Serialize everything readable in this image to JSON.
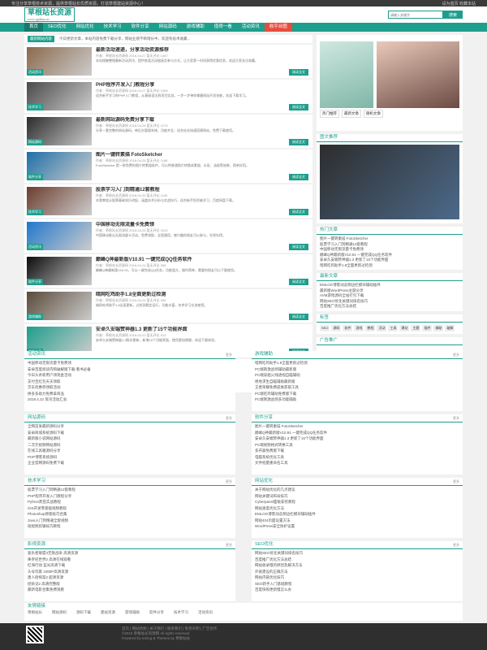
{
  "topbar": {
    "left": "专注分享草根技术资源，提供草根站长优质资源，打造草根建站资源中心！",
    "right": "设为首页 收藏本站"
  },
  "brand": {
    "title": "草根站长资源",
    "url": "www.cgzhan.cn"
  },
  "search": {
    "placeholder": "请输入关键字",
    "button": "搜索"
  },
  "nav": [
    "首页",
    "SEO优化",
    "网站优化",
    "技术学习",
    "软件分享",
    "网站源码",
    "游戏辅助",
    "值得一看",
    "活动资讯",
    "收平台图"
  ],
  "notice": {
    "label": "最新网站内容",
    "text": "今日更新文章，本站内容免费下载分享，网站业绩不断增长中，欢迎有技术收藏..."
  },
  "posts": [
    {
      "tag": "活动资讯",
      "title": "最新活动速递，分享活动资源推荐",
      "meta": "作者：草根站长资源网  2018-04-27  暂无评论  1467",
      "excerpt": "本站搜集整理最新活动资讯，提供各类活动链接及参与方式，让大家第一时间获得优惠信息，欢迎大家关注收藏。"
    },
    {
      "tag": "技术学习",
      "title": "PHP程序开发入门教程分享",
      "meta": "作者：草根站长资源网  2018-04-27  暂无评论  1389",
      "excerpt": "适合新手学习的PHP入门教程，从基础语法到项目实战，一步一步带你掌握网站开发技能，欢迎下载学习。"
    },
    {
      "tag": "网站源码",
      "title": "最新网站源码免费分享下载",
      "meta": "作者：草根站长资源网  2018-04-26  暂无评论  1274",
      "excerpt": "分享一套完整的网站源码，带后台管理系统，功能齐全，适合站长快速搭建网站，免费下载使用。"
    },
    {
      "tag": "软件分享",
      "title": "图片一键转素描 FotoSketcher",
      "meta": "作者：草根站长资源网  2018-04-26  暂无评论  1188",
      "excerpt": "FotoSketcher 是一款免费的图片转素描软件，可以将普通照片转换成素描、水彩、油画等效果，简单好用。"
    },
    {
      "tag": "技术学习",
      "title": "股票学习入门到精通12套教程",
      "meta": "作者：草根站长资源网  2018-04-25  暂无评论  1105",
      "excerpt": "本套教程从股票基础知识讲起，涵盖技术分析与实战技巧，适合新手投资者学习，百度网盘下载。"
    },
    {
      "tag": "活动资讯",
      "title": "中国移动无限流量卡免费领",
      "meta": "作者：草根站长资源网  2018-04-25  暂无评论  1032",
      "excerpt": "中国移动推出无限流量卡活动，免费领取，全国通用，感兴趣的朋友可以参与，先到先得。"
    },
    {
      "tag": "软件分享",
      "title": "巅峰Q神最新版V10.91 一键完成QQ任务软件",
      "meta": "作者：草根站长资源网  2018-04-24  暂无评论  998",
      "excerpt": "巅峰Q神最新版V10.91，可以一键完成QQ任务，功能强大，操作简单，需要的朋友可以下载使用。"
    },
    {
      "tag": "游戏辅助",
      "title": "暗网吃鸡助手1.8全面更新过检测",
      "meta": "作者：草根站长资源网  2018-04-24  暂无评论  956",
      "excerpt": "暗网吃鸡助手1.8全面更新，过检测稳定运行，功能丰富，仅供学习交流使用。"
    },
    {
      "tag": "软件分享",
      "title": "安卓久安端赞神器1.3 更新了15个功能界面",
      "meta": "作者：草根站长资源网  2018-04-23  暂无评论  913",
      "excerpt": "安卓久安端赞神器1.3版本更新，新增15个功能界面，使用更加便捷，欢迎下载体验。"
    },
    {
      "tag": "活动资讯",
      "title": "安卓百度阅读内购破解版下载 看书必备",
      "meta": "作者：草根站长资源网  2018-04-23  暂无评论  887",
      "excerpt": "安卓百度阅读内购破解版，海量书籍免费阅读，看书必备神器，喜欢阅读的朋友不要错过。"
    }
  ],
  "post_more": "阅读全文",
  "pager": [
    "1",
    "2",
    "3",
    "4",
    "5",
    "»"
  ],
  "sidebar": {
    "tabs": [
      "热门推荐",
      "最新文章",
      "随机文章"
    ],
    "tab2": {
      "title": "图文推荐"
    },
    "hot": {
      "title": "热门文章",
      "items": [
        "图片一键转素描 FotoSketcher",
        "股票学习入门到精通12套教程",
        "中国移动无限流量卡免费领",
        "巅峰Q神最新版V10.91 一键完成QQ任务软件",
        "安卓久安端赞神器1.3 更新了15个功能界面",
        "暗网吃鸡助手1.8全面更新过检测"
      ]
    },
    "recent": {
      "title": "最新文章",
      "items": [
        "EMLOG博客动态侧边栏模块辅助插件",
        "最新版WordPress主题分享",
        "AVM游戏源码全站打包下载",
        "网站SEO优化关键词排名技巧",
        "百度推广优化方法总结"
      ]
    },
    "tags": {
      "title": "标签",
      "items": [
        "SEO",
        "源码",
        "软件",
        "游戏",
        "教程",
        "活动",
        "工具",
        "建站",
        "主题",
        "插件",
        "辅助",
        "破解"
      ]
    },
    "ad": {
      "title": "广告推广"
    }
  },
  "sections": [
    {
      "title": "活动资讯",
      "more": "更多",
      "items": [
        "中国移动无限流量卡免费领",
        "安卓百度阅读内购破解版下载 看书必备",
        "今日头条新用户领现金活动",
        "支付宝红包天天领取",
        "京东优惠券领取活动",
        "拼多多助力免费拿商品",
        "2018.4.22 资讯活动汇总"
      ]
    },
    {
      "title": "游戏辅助",
      "more": "更多",
      "items": [
        "暗网吃鸡助手1.8全面更新过检测",
        "PC端刺激战场辅助最新版",
        "PC端穿越火线透视自瞄辅助",
        "绝地求生自瞄辅助最新版",
        "王者荣耀免费皮肤获取工具",
        "PC端吃鸡辅助免费版下载",
        "PC端刺激战场多功能辅助"
      ]
    },
    {
      "title": "网站源码",
      "more": "更多",
      "items": [
        "全网首发最新源码分享",
        "安卓商城系统源码下载",
        "最新版小说网站源码",
        "二次元视频网站源码",
        "在线工具箱源码分享",
        "PHP博客系统源码",
        "企业官网源码免费下载"
      ]
    },
    {
      "title": "软件分享",
      "more": "更多",
      "items": [
        "图片一键转素描 FotoSketcher",
        "巅峰Q神最新版V10.91 一键完成QQ任务软件",
        "安卓久安端赞神器1.3 更新了15个功能界面",
        "PC端视频格式转换工具",
        "多开器免费版下载",
        "电脑系统优化工具",
        "文件批量重命名工具"
      ]
    },
    {
      "title": "技术学习",
      "more": "更多",
      "items": [
        "股票学习入门到精通12套教程",
        "PHP程序开发入门教程分享",
        "Python爬虫实战教程",
        "iOS开发零基础视频教程",
        "Photoshop修图技巧合集",
        "Java入门到精通全套视频",
        "短视频剪辑技巧教程"
      ]
    },
    {
      "title": "网站优化",
      "more": "更多",
      "items": [
        "关于网站优化的几点建议",
        "网站关键词布局技巧",
        "Cyberpanel面板安装教程",
        "网站速度优化方法",
        "EMLOG博客动态侧边栏模块辅助插件",
        "网站404页面设置方法",
        "WordPress安全防护设置"
      ]
    },
    {
      "title": "影视资源",
      "more": "更多",
      "items": [
        "复仇者联盟3无限战争 高清资源",
        "侏罗纪世界2 高清在线观看",
        "红海行动 蓝光高清下载",
        "头号玩家 1080P高清资源",
        "唐人街探案2 超清资源",
        "捉妖记2 高清完整版",
        "最新电影合集免费观看"
      ]
    },
    {
      "title": "SEO优化",
      "more": "更多",
      "items": [
        "网站SEO优化关键词排名技巧",
        "百度推广优化方法总结",
        "网站收录慢的原因及解决方法",
        "外链建设的正确方法",
        "网站内链优化技巧",
        "SEO新手入门基础教程",
        "百度快照更新慢怎么办"
      ]
    }
  ],
  "links": {
    "title": "友情链接",
    "items": [
      "草根站长",
      "网站源码",
      "源码下载",
      "建站资源",
      "游戏辅助",
      "软件分享",
      "技术学习",
      "活动资讯"
    ]
  },
  "footer": {
    "links": "首页 | 网站地图 | 关于我们 | 联系我们 | 免责声明 | 广告合作",
    "copy": "©2018 草根站长资源网 All rights reserved",
    "powered": "Powered by emlog & Themes by 草根站长"
  }
}
